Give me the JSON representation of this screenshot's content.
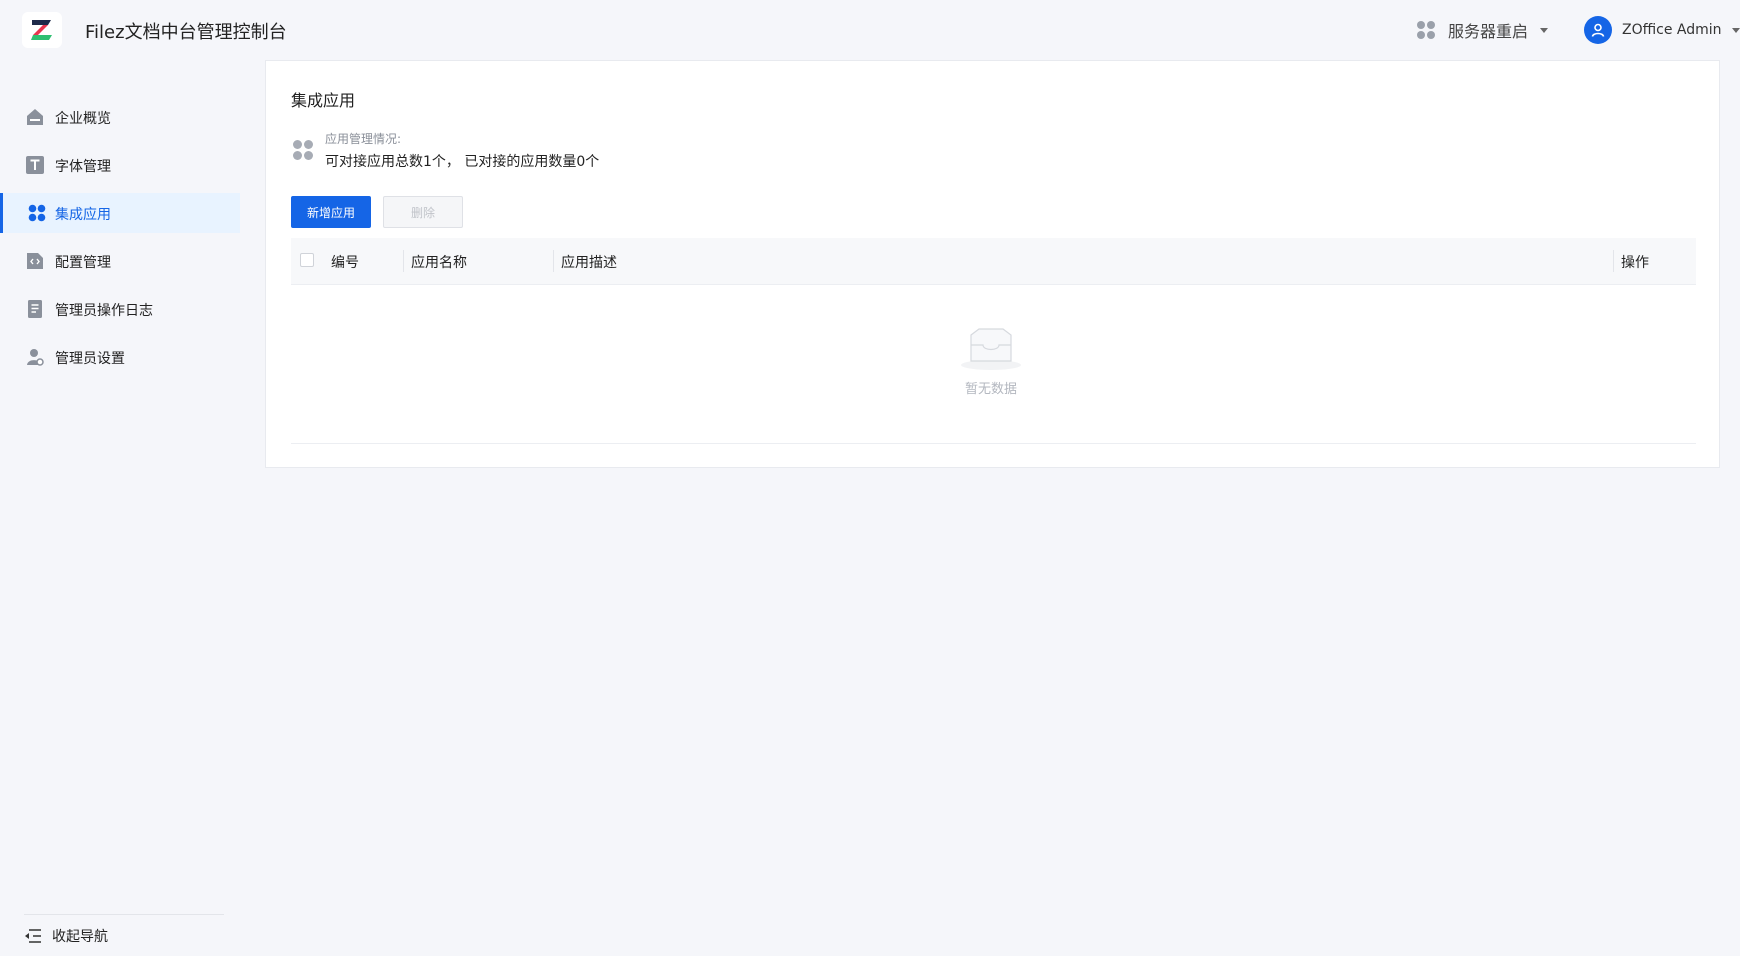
{
  "header": {
    "logo_letter": "Z",
    "title": "Filez文档中台管理控制台",
    "server_restart": "服务器重启",
    "user_name": "ZOffice Admin"
  },
  "sidebar": {
    "items": [
      {
        "label": "企业概览",
        "icon": "home-icon"
      },
      {
        "label": "字体管理",
        "icon": "font-icon"
      },
      {
        "label": "集成应用",
        "icon": "apps-icon",
        "active": true
      },
      {
        "label": "配置管理",
        "icon": "config-icon"
      },
      {
        "label": "管理员操作日志",
        "icon": "log-icon"
      },
      {
        "label": "管理员设置",
        "icon": "admin-icon"
      }
    ],
    "collapse_label": "收起导航"
  },
  "main": {
    "title": "集成应用",
    "summary_label": "应用管理情况:",
    "summary_text": "可对接应用总数1个， 已对接的应用数量0个",
    "add_button": "新增应用",
    "delete_button": "删除",
    "table": {
      "columns": [
        "编号",
        "应用名称",
        "应用描述",
        "操作"
      ],
      "rows": [],
      "empty_text": "暂无数据"
    }
  },
  "colors": {
    "primary": "#1565e6",
    "active_bg": "#e8f3ff",
    "background": "#f5f6fa"
  }
}
